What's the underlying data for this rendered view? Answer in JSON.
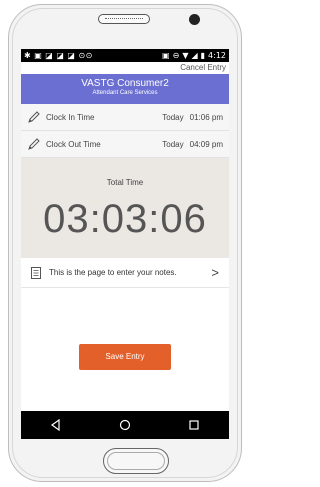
{
  "status_bar": {
    "left_icons": [
      "notification-icon",
      "photo-icon",
      "notification-icon",
      "notification-icon",
      "notification-icon",
      "voicemail-icon"
    ],
    "time": "4:12"
  },
  "top": {
    "cancel_label": "Cancel Entry"
  },
  "header": {
    "title": "VASTG Consumer2",
    "subtitle": "Attendant Care Services",
    "color": "#6b6fd1"
  },
  "clock_in": {
    "label": "Clock In Time",
    "day": "Today",
    "time": "01:06 pm"
  },
  "clock_out": {
    "label": "Clock Out Time",
    "day": "Today",
    "time": "04:09 pm"
  },
  "total": {
    "label": "Total Time",
    "value": "03:03:06"
  },
  "notes": {
    "text": "This is the page to enter your notes."
  },
  "save": {
    "label": "Save Entry",
    "color": "#e4602a"
  },
  "nav_bar": {
    "buttons": [
      "back-icon",
      "home-icon",
      "recents-icon"
    ]
  }
}
